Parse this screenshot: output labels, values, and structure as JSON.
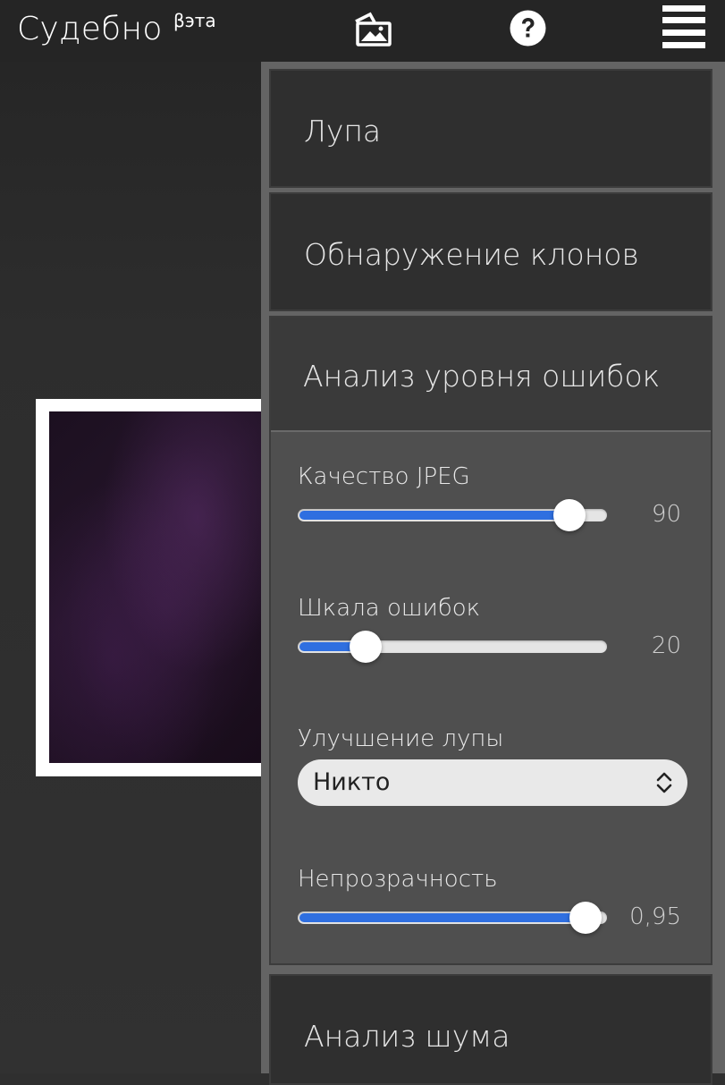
{
  "header": {
    "title": "Судебно",
    "beta": "βэта",
    "icons": [
      "image-icon",
      "help-icon",
      "menu-icon"
    ]
  },
  "panel": {
    "loupe": {
      "label": "Лупа"
    },
    "clone_detection": {
      "label": "Обнаружение клонов"
    },
    "ela": {
      "label": "Анализ уровня ошибок",
      "jpeg_quality": {
        "label": "Качество JPEG",
        "value": "90",
        "fraction": 0.88
      },
      "error_scale": {
        "label": "Шкала ошибок",
        "value": "20",
        "fraction": 0.22
      },
      "magnifier_enhancement": {
        "label": "Улучшение лупы",
        "selected": "Никто"
      },
      "opacity": {
        "label": "Непрозрачность",
        "value": "0,95",
        "fraction": 0.93
      }
    },
    "noise_analysis": {
      "label": "Анализ шума"
    }
  },
  "colors": {
    "topbar": "#252525",
    "panel_bg": "#646464",
    "slider_accent": "#2f6fe0"
  }
}
